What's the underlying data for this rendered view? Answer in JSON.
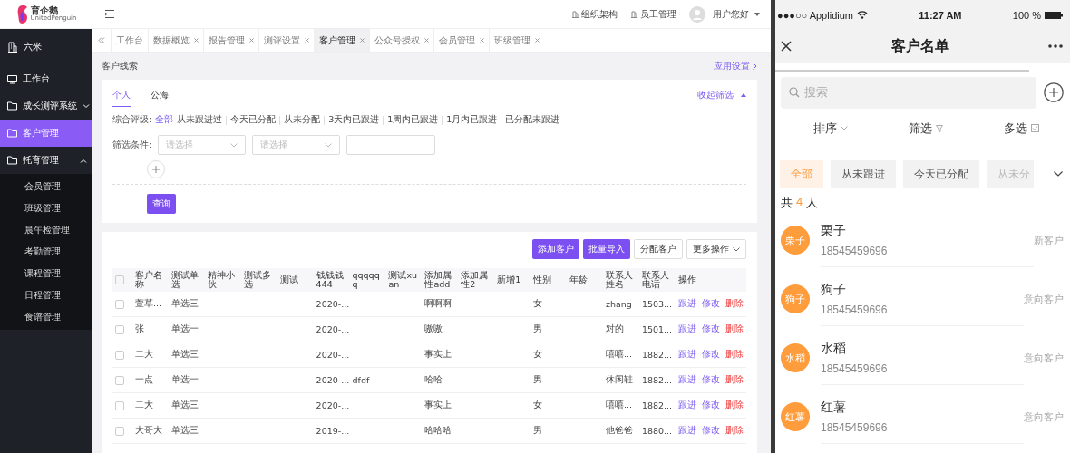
{
  "header": {
    "logo": {
      "name": "育企鹅",
      "subtitle": "UnitedPenguin"
    },
    "links": [
      {
        "label": "组织架构"
      },
      {
        "label": "员工管理"
      }
    ],
    "user": "用户您好"
  },
  "sidebar": {
    "org": "六米",
    "items": [
      {
        "label": "工作台",
        "selected": false
      },
      {
        "label": "成长测评系统",
        "selected": false,
        "expanded": false
      },
      {
        "label": "客户管理",
        "selected": true
      },
      {
        "label": "托育管理",
        "selected": false,
        "expanded": true,
        "children": [
          {
            "label": "会员管理"
          },
          {
            "label": "班级管理"
          },
          {
            "label": "晨午检管理"
          },
          {
            "label": "考勤管理"
          },
          {
            "label": "课程管理"
          },
          {
            "label": "日程管理"
          },
          {
            "label": "食谱管理"
          }
        ]
      }
    ]
  },
  "tabs": [
    {
      "label": "工作台",
      "selected": false,
      "closable": false
    },
    {
      "label": "数据概览",
      "selected": false,
      "closable": true
    },
    {
      "label": "报告管理",
      "selected": false,
      "closable": true
    },
    {
      "label": "测评设置",
      "selected": false,
      "closable": true
    },
    {
      "label": "客户管理",
      "selected": true,
      "closable": true
    },
    {
      "label": "公众号授权",
      "selected": false,
      "closable": true
    },
    {
      "label": "会员管理",
      "selected": false,
      "closable": true
    },
    {
      "label": "班级管理",
      "selected": false,
      "closable": true
    }
  ],
  "breadcrumb": "客户线索",
  "settings_link": "应用设置",
  "filter": {
    "subtabs": [
      {
        "label": "个人",
        "selected": true
      },
      {
        "label": "公海",
        "selected": false
      }
    ],
    "collapse_link": "收起筛选",
    "rating_label": "综合评级:",
    "ratings": [
      {
        "label": "全部",
        "selected": true
      },
      {
        "label": "从未跟进过",
        "selected": false
      },
      {
        "label": "今天已分配",
        "selected": false
      },
      {
        "label": "从未分配",
        "selected": false
      },
      {
        "label": "3天内已跟进",
        "selected": false
      },
      {
        "label": "1周内已跟进",
        "selected": false
      },
      {
        "label": "1月内已跟进",
        "selected": false
      },
      {
        "label": "已分配未跟进",
        "selected": false
      }
    ],
    "condition_label": "筛选条件:",
    "selects": [
      {
        "placeholder": "请选择"
      },
      {
        "placeholder": "请选择"
      }
    ],
    "query_button": "查询"
  },
  "toolbar": [
    {
      "label": "添加客户",
      "kind": "primary"
    },
    {
      "label": "批量导入",
      "kind": "primary"
    },
    {
      "label": "分配客户",
      "kind": "plain"
    },
    {
      "label": "更多操作",
      "kind": "menu"
    }
  ],
  "table": {
    "header_checked": false,
    "columns": [
      "客户名称",
      "测试单选",
      "精神小伙",
      "测试多选",
      "测试",
      "钱钱钱444",
      "qqqqqq",
      "测试xuan",
      "添加属性add",
      "添加属性2",
      "新增1",
      "性别",
      "年龄",
      "联系人姓名",
      "联系人电话",
      "操作"
    ],
    "rows": [
      {
        "checked": false,
        "cells": [
          "萱草...",
          "单选三",
          null,
          null,
          null,
          "2020-...",
          null,
          null,
          "啊啊啊",
          null,
          null,
          "女",
          null,
          "zhang",
          "1503..."
        ],
        "actions": [
          {
            "label": "跟进",
            "kind": "normal"
          },
          {
            "label": "修改",
            "kind": "normal"
          },
          {
            "label": "删除",
            "kind": "danger"
          }
        ]
      },
      {
        "checked": false,
        "cells": [
          "张",
          "单选一",
          null,
          null,
          null,
          "2020-...",
          null,
          null,
          "嗷嗷",
          null,
          null,
          "男",
          null,
          "对的",
          "1501..."
        ],
        "actions": [
          {
            "label": "跟进",
            "kind": "normal"
          },
          {
            "label": "修改",
            "kind": "normal"
          },
          {
            "label": "删除",
            "kind": "danger"
          }
        ]
      },
      {
        "checked": false,
        "cells": [
          "二大",
          "单选三",
          null,
          null,
          null,
          "2020-...",
          null,
          null,
          "事实上",
          null,
          null,
          "女",
          null,
          "嘻嘻...",
          "1882..."
        ],
        "actions": [
          {
            "label": "跟进",
            "kind": "normal"
          },
          {
            "label": "修改",
            "kind": "normal"
          },
          {
            "label": "删除",
            "kind": "danger"
          }
        ]
      },
      {
        "checked": false,
        "cells": [
          "一点",
          "单选一",
          null,
          null,
          null,
          "2020-...",
          "dfdf",
          null,
          "哈哈",
          null,
          null,
          "男",
          null,
          "休闲鞋",
          "1882..."
        ],
        "actions": [
          {
            "label": "跟进",
            "kind": "normal"
          },
          {
            "label": "修改",
            "kind": "normal"
          },
          {
            "label": "删除",
            "kind": "danger"
          }
        ]
      },
      {
        "checked": false,
        "cells": [
          "二大",
          "单选三",
          null,
          null,
          null,
          "2020-...",
          null,
          null,
          "事实上",
          null,
          null,
          "女",
          null,
          "嘻嘻...",
          "1882..."
        ],
        "actions": [
          {
            "label": "跟进",
            "kind": "normal"
          },
          {
            "label": "修改",
            "kind": "normal"
          },
          {
            "label": "删除",
            "kind": "danger"
          }
        ]
      },
      {
        "checked": false,
        "cells": [
          "大哥大",
          "单选三",
          null,
          null,
          null,
          "2019-...",
          null,
          null,
          "哈哈哈",
          null,
          null,
          "男",
          null,
          "他爸爸",
          "1880..."
        ],
        "actions": [
          {
            "label": "跟进",
            "kind": "normal"
          },
          {
            "label": "修改",
            "kind": "normal"
          },
          {
            "label": "删除",
            "kind": "danger"
          }
        ]
      }
    ]
  },
  "phone": {
    "status_bar": {
      "carrier": "●●●○○ Applidium",
      "time": "11:27 AM",
      "battery": "100 %"
    },
    "title": "客户名单",
    "search": {
      "placeholder": "搜索"
    },
    "sort_options": [
      {
        "label": "排序",
        "kind": "dropdown"
      },
      {
        "label": "筛选",
        "kind": "filter"
      },
      {
        "label": "多选",
        "kind": "check"
      }
    ],
    "chips": [
      {
        "label": "全部",
        "selected": true
      },
      {
        "label": "从未跟进",
        "selected": false
      },
      {
        "label": "今天已分配",
        "selected": false
      },
      {
        "label": "从未分",
        "selected": false
      }
    ],
    "count": {
      "prefix": "共",
      "value": "4",
      "suffix": "人"
    },
    "customers": [
      {
        "avatar": "栗子",
        "name": "栗子",
        "phone": "18545459696",
        "status": "新客户"
      },
      {
        "avatar": "狗子",
        "name": "狗子",
        "phone": "18545459696",
        "status": "意向客户"
      },
      {
        "avatar": "水稻",
        "name": "水稻",
        "phone": "18545459696",
        "status": "意向客户"
      },
      {
        "avatar": "红薯",
        "name": "红薯",
        "phone": "18545459696",
        "status": "意向客户"
      }
    ]
  }
}
